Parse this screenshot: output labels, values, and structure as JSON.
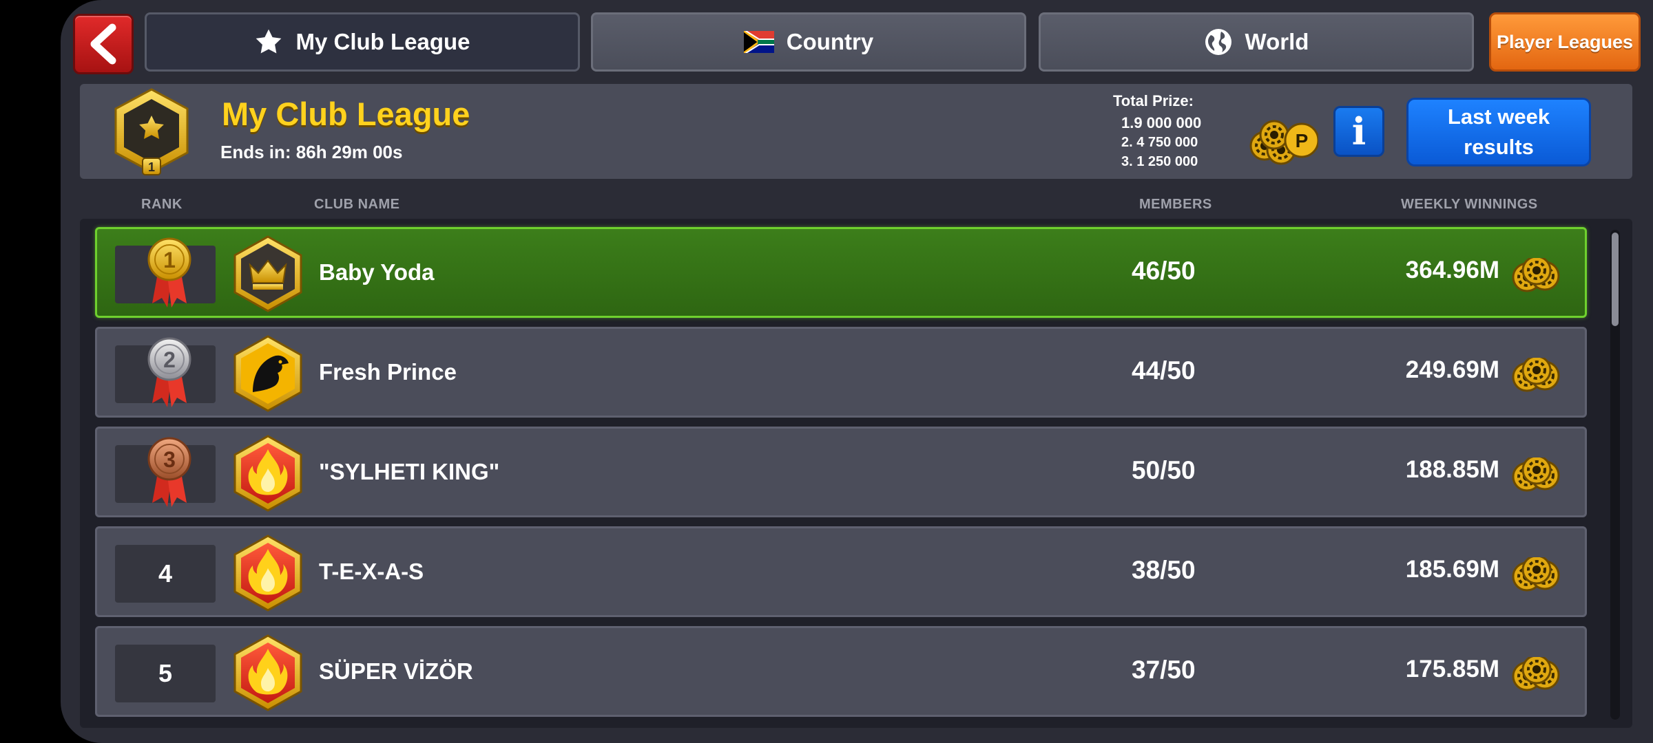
{
  "tabs": [
    {
      "label": "My Club League",
      "icon": "star-icon",
      "active": true
    },
    {
      "label": "Country",
      "icon": "south-africa-flag-icon",
      "active": false
    },
    {
      "label": "World",
      "icon": "globe-icon",
      "active": false
    }
  ],
  "player_leagues_label": "Player Leagues",
  "league": {
    "title": "My Club League",
    "ends_in": "Ends in: 86h 29m 00s",
    "badge_level": "1",
    "total_prize_label": "Total Prize:",
    "prizes": [
      "1.9 000 000",
      "2.  4 750 000",
      "3.  1 250 000"
    ]
  },
  "last_week_label": "Last week\nresults",
  "info_label": "i",
  "columns": {
    "rank": "RANK",
    "club_name": "CLUB NAME",
    "members": "MEMBERS",
    "weekly_winnings": "WEEKLY WINNINGS"
  },
  "clubs": [
    {
      "rank": "1",
      "name": "Baby Yoda",
      "members": "46/50",
      "winnings": "364.96M",
      "badge": "crown",
      "medal": "gold"
    },
    {
      "rank": "2",
      "name": "Fresh Prince",
      "members": "44/50",
      "winnings": "249.69M",
      "badge": "eagle",
      "medal": "silver"
    },
    {
      "rank": "3",
      "name": "\"SYLHETI KING\"",
      "members": "50/50",
      "winnings": "188.85M",
      "badge": "flame",
      "medal": "bronze"
    },
    {
      "rank": "4",
      "name": "T-E-X-A-S",
      "members": "38/50",
      "winnings": "185.69M",
      "badge": "flame",
      "medal": null
    },
    {
      "rank": "5",
      "name": "SÜPER VİZÖR",
      "members": "37/50",
      "winnings": "175.85M",
      "badge": "flame",
      "medal": null
    }
  ],
  "colors": {
    "highlight_row": "#3c7e1a",
    "league_title": "#ffd21e",
    "back_button": "#d22020",
    "player_leagues_button": "#f07e22",
    "blue_button": "#1470e6"
  }
}
